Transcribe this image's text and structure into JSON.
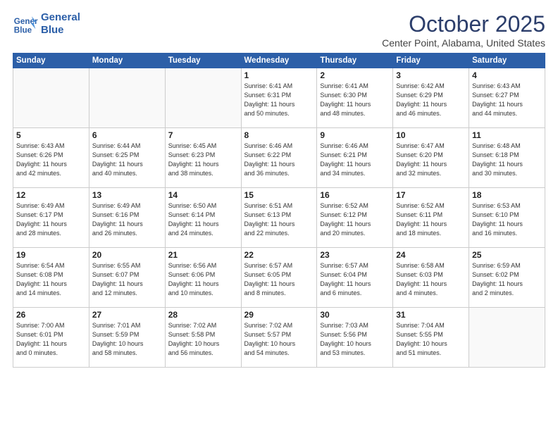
{
  "header": {
    "logo_line1": "General",
    "logo_line2": "Blue",
    "month": "October 2025",
    "location": "Center Point, Alabama, United States"
  },
  "weekdays": [
    "Sunday",
    "Monday",
    "Tuesday",
    "Wednesday",
    "Thursday",
    "Friday",
    "Saturday"
  ],
  "weeks": [
    [
      {
        "day": "",
        "info": ""
      },
      {
        "day": "",
        "info": ""
      },
      {
        "day": "",
        "info": ""
      },
      {
        "day": "1",
        "info": "Sunrise: 6:41 AM\nSunset: 6:31 PM\nDaylight: 11 hours\nand 50 minutes."
      },
      {
        "day": "2",
        "info": "Sunrise: 6:41 AM\nSunset: 6:30 PM\nDaylight: 11 hours\nand 48 minutes."
      },
      {
        "day": "3",
        "info": "Sunrise: 6:42 AM\nSunset: 6:29 PM\nDaylight: 11 hours\nand 46 minutes."
      },
      {
        "day": "4",
        "info": "Sunrise: 6:43 AM\nSunset: 6:27 PM\nDaylight: 11 hours\nand 44 minutes."
      }
    ],
    [
      {
        "day": "5",
        "info": "Sunrise: 6:43 AM\nSunset: 6:26 PM\nDaylight: 11 hours\nand 42 minutes."
      },
      {
        "day": "6",
        "info": "Sunrise: 6:44 AM\nSunset: 6:25 PM\nDaylight: 11 hours\nand 40 minutes."
      },
      {
        "day": "7",
        "info": "Sunrise: 6:45 AM\nSunset: 6:23 PM\nDaylight: 11 hours\nand 38 minutes."
      },
      {
        "day": "8",
        "info": "Sunrise: 6:46 AM\nSunset: 6:22 PM\nDaylight: 11 hours\nand 36 minutes."
      },
      {
        "day": "9",
        "info": "Sunrise: 6:46 AM\nSunset: 6:21 PM\nDaylight: 11 hours\nand 34 minutes."
      },
      {
        "day": "10",
        "info": "Sunrise: 6:47 AM\nSunset: 6:20 PM\nDaylight: 11 hours\nand 32 minutes."
      },
      {
        "day": "11",
        "info": "Sunrise: 6:48 AM\nSunset: 6:18 PM\nDaylight: 11 hours\nand 30 minutes."
      }
    ],
    [
      {
        "day": "12",
        "info": "Sunrise: 6:49 AM\nSunset: 6:17 PM\nDaylight: 11 hours\nand 28 minutes."
      },
      {
        "day": "13",
        "info": "Sunrise: 6:49 AM\nSunset: 6:16 PM\nDaylight: 11 hours\nand 26 minutes."
      },
      {
        "day": "14",
        "info": "Sunrise: 6:50 AM\nSunset: 6:14 PM\nDaylight: 11 hours\nand 24 minutes."
      },
      {
        "day": "15",
        "info": "Sunrise: 6:51 AM\nSunset: 6:13 PM\nDaylight: 11 hours\nand 22 minutes."
      },
      {
        "day": "16",
        "info": "Sunrise: 6:52 AM\nSunset: 6:12 PM\nDaylight: 11 hours\nand 20 minutes."
      },
      {
        "day": "17",
        "info": "Sunrise: 6:52 AM\nSunset: 6:11 PM\nDaylight: 11 hours\nand 18 minutes."
      },
      {
        "day": "18",
        "info": "Sunrise: 6:53 AM\nSunset: 6:10 PM\nDaylight: 11 hours\nand 16 minutes."
      }
    ],
    [
      {
        "day": "19",
        "info": "Sunrise: 6:54 AM\nSunset: 6:08 PM\nDaylight: 11 hours\nand 14 minutes."
      },
      {
        "day": "20",
        "info": "Sunrise: 6:55 AM\nSunset: 6:07 PM\nDaylight: 11 hours\nand 12 minutes."
      },
      {
        "day": "21",
        "info": "Sunrise: 6:56 AM\nSunset: 6:06 PM\nDaylight: 11 hours\nand 10 minutes."
      },
      {
        "day": "22",
        "info": "Sunrise: 6:57 AM\nSunset: 6:05 PM\nDaylight: 11 hours\nand 8 minutes."
      },
      {
        "day": "23",
        "info": "Sunrise: 6:57 AM\nSunset: 6:04 PM\nDaylight: 11 hours\nand 6 minutes."
      },
      {
        "day": "24",
        "info": "Sunrise: 6:58 AM\nSunset: 6:03 PM\nDaylight: 11 hours\nand 4 minutes."
      },
      {
        "day": "25",
        "info": "Sunrise: 6:59 AM\nSunset: 6:02 PM\nDaylight: 11 hours\nand 2 minutes."
      }
    ],
    [
      {
        "day": "26",
        "info": "Sunrise: 7:00 AM\nSunset: 6:01 PM\nDaylight: 11 hours\nand 0 minutes."
      },
      {
        "day": "27",
        "info": "Sunrise: 7:01 AM\nSunset: 5:59 PM\nDaylight: 10 hours\nand 58 minutes."
      },
      {
        "day": "28",
        "info": "Sunrise: 7:02 AM\nSunset: 5:58 PM\nDaylight: 10 hours\nand 56 minutes."
      },
      {
        "day": "29",
        "info": "Sunrise: 7:02 AM\nSunset: 5:57 PM\nDaylight: 10 hours\nand 54 minutes."
      },
      {
        "day": "30",
        "info": "Sunrise: 7:03 AM\nSunset: 5:56 PM\nDaylight: 10 hours\nand 53 minutes."
      },
      {
        "day": "31",
        "info": "Sunrise: 7:04 AM\nSunset: 5:55 PM\nDaylight: 10 hours\nand 51 minutes."
      },
      {
        "day": "",
        "info": ""
      }
    ]
  ]
}
